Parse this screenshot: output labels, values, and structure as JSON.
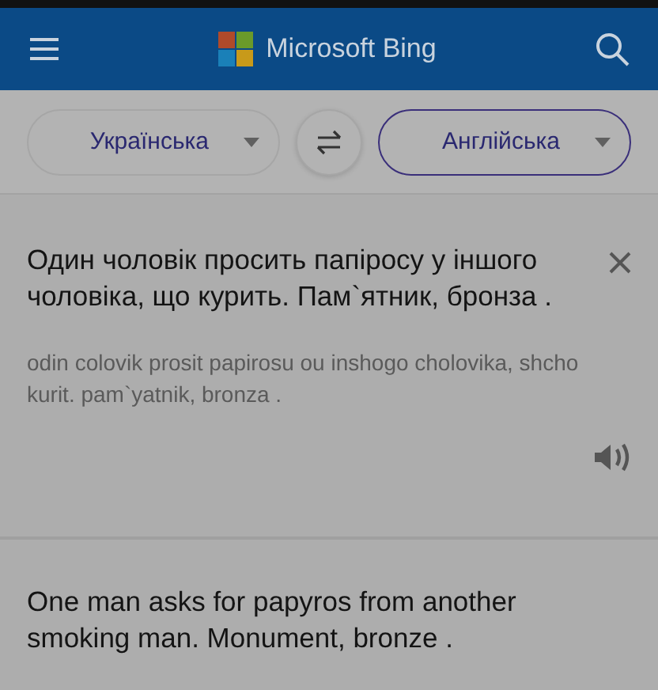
{
  "header": {
    "title": "Microsoft Bing"
  },
  "languages": [
    {
      "label": "Українська",
      "selected": false
    },
    {
      "label": "Англійська",
      "selected": true
    }
  ],
  "source": {
    "text": "Один чоловік просить папіросу у іншого чоловіка, що курить. Пам`ятник, бронза .",
    "transliteration": "odin colovik prosit papirosu ou inshogo cholovika, shcho kurit. pam`yatnik, bronza ."
  },
  "result": {
    "text": "One man asks for papyros from another smoking man. Monument, bronze ."
  }
}
